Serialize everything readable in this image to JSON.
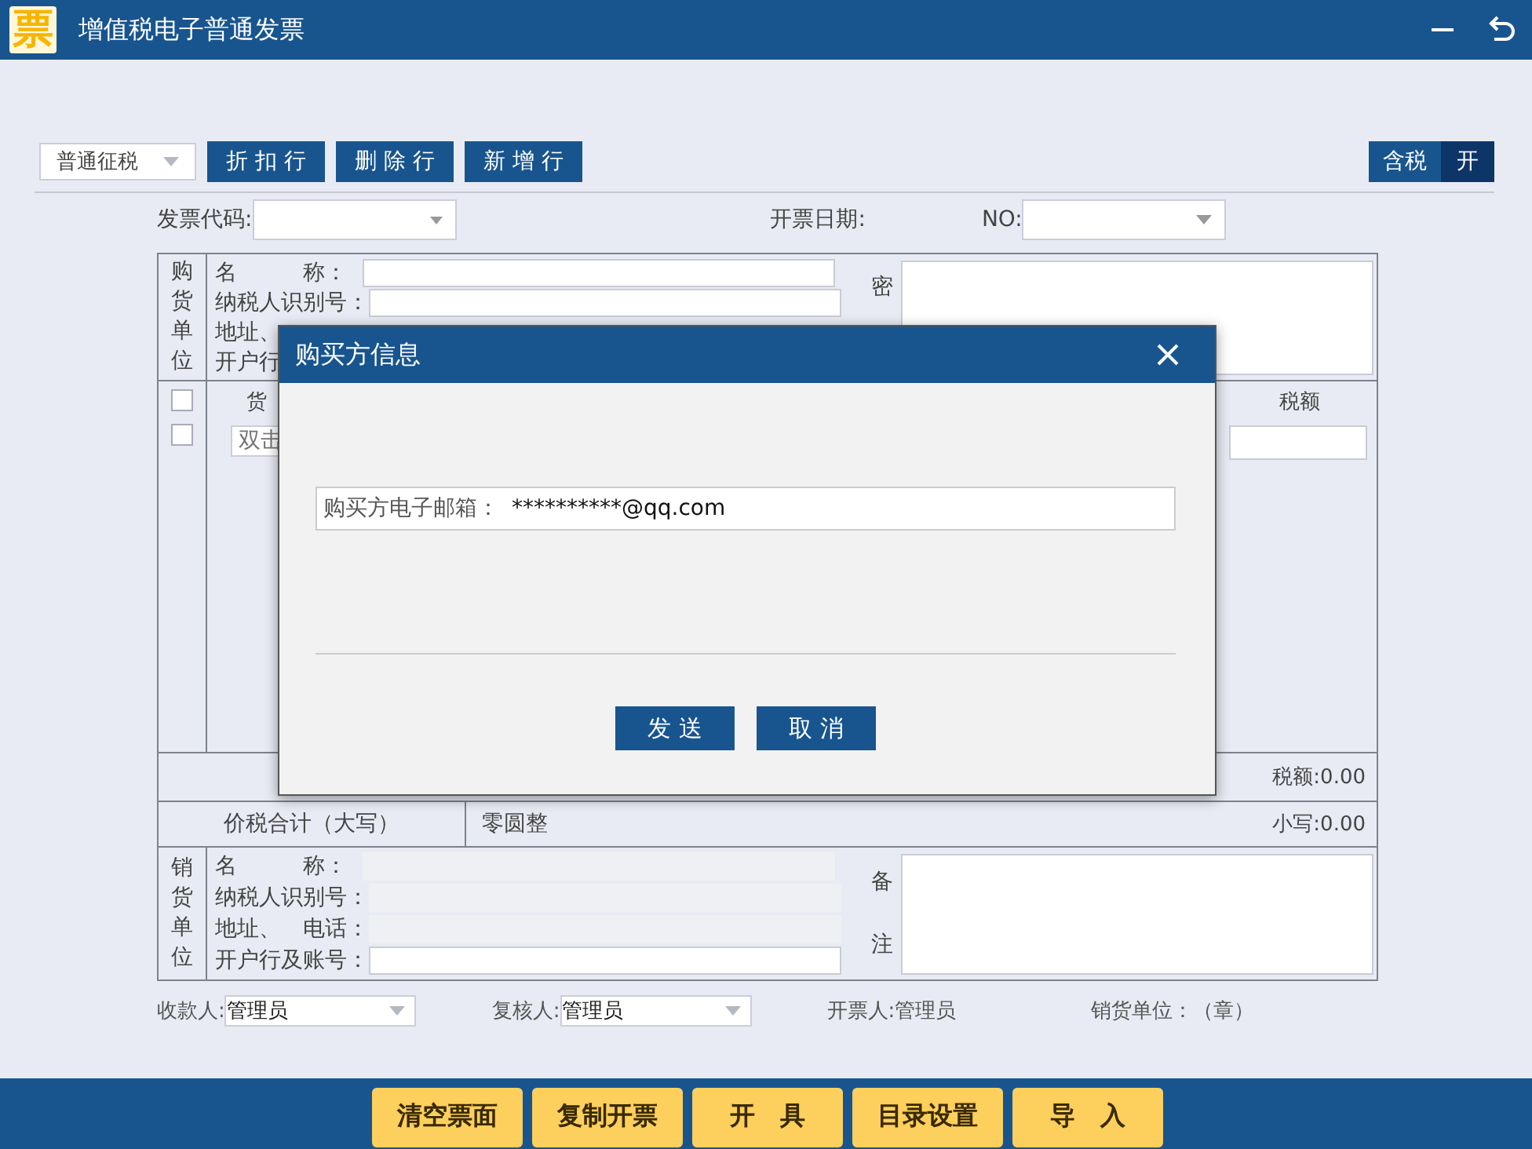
{
  "window": {
    "logo": "票",
    "title": "增值税电子普通发票"
  },
  "toolbar": {
    "tax_type": "普通征税",
    "buttons": [
      "折 扣 行",
      "删 除 行",
      "新 增 行"
    ],
    "toggle": {
      "label": "含税",
      "state": "开",
      "on": true
    }
  },
  "header": {
    "code_label": "发票代码:",
    "date_label": "开票日期:",
    "no_label": "NO:"
  },
  "buyer": {
    "side_label": "购货单位",
    "cipher_label": "密",
    "fields": [
      {
        "label": "名　　　称：",
        "kind": "field",
        "readonly": false
      },
      {
        "label": "纳税人识别号：",
        "kind": "field",
        "readonly": false
      },
      {
        "label": "地址、",
        "kind": "label"
      },
      {
        "label": "开户行",
        "kind": "label"
      }
    ]
  },
  "goods": {
    "column_1": "货",
    "tax_column": "税额",
    "rows": [
      {
        "checked": false,
        "placeholder": "双击"
      }
    ],
    "header_checked": false
  },
  "tax_total": "税额:0.00",
  "sum": {
    "label": "价税合计（大写）",
    "words": "零圆整",
    "small": "小写:0.00"
  },
  "seller": {
    "side_label": "销货单位",
    "remark_label": "备注",
    "fields": [
      {
        "label": "名　　　称：",
        "kind": "field",
        "readonly": true
      },
      {
        "label": "纳税人识别号：",
        "kind": "field",
        "readonly": true
      },
      {
        "label": "地址、　电话：",
        "kind": "field",
        "readonly": true
      },
      {
        "label": "开户行及账号：",
        "kind": "field",
        "readonly": false
      }
    ]
  },
  "signers": [
    {
      "label": "收款人:",
      "value": "管理员",
      "kind": "select"
    },
    {
      "label": "复核人:",
      "value": "管理员",
      "kind": "select"
    },
    {
      "label": "开票人:管理员",
      "kind": "text"
    },
    {
      "label": "销货单位：（章）",
      "kind": "text"
    }
  ],
  "actions": [
    "清空票面",
    "复制开票",
    "开　具",
    "目录设置",
    "导　入"
  ],
  "dialog": {
    "title": "购买方信息",
    "email_label": "购买方电子邮箱：",
    "email": "**********@qq.com",
    "buttons": [
      "发 送",
      "取 消"
    ]
  }
}
